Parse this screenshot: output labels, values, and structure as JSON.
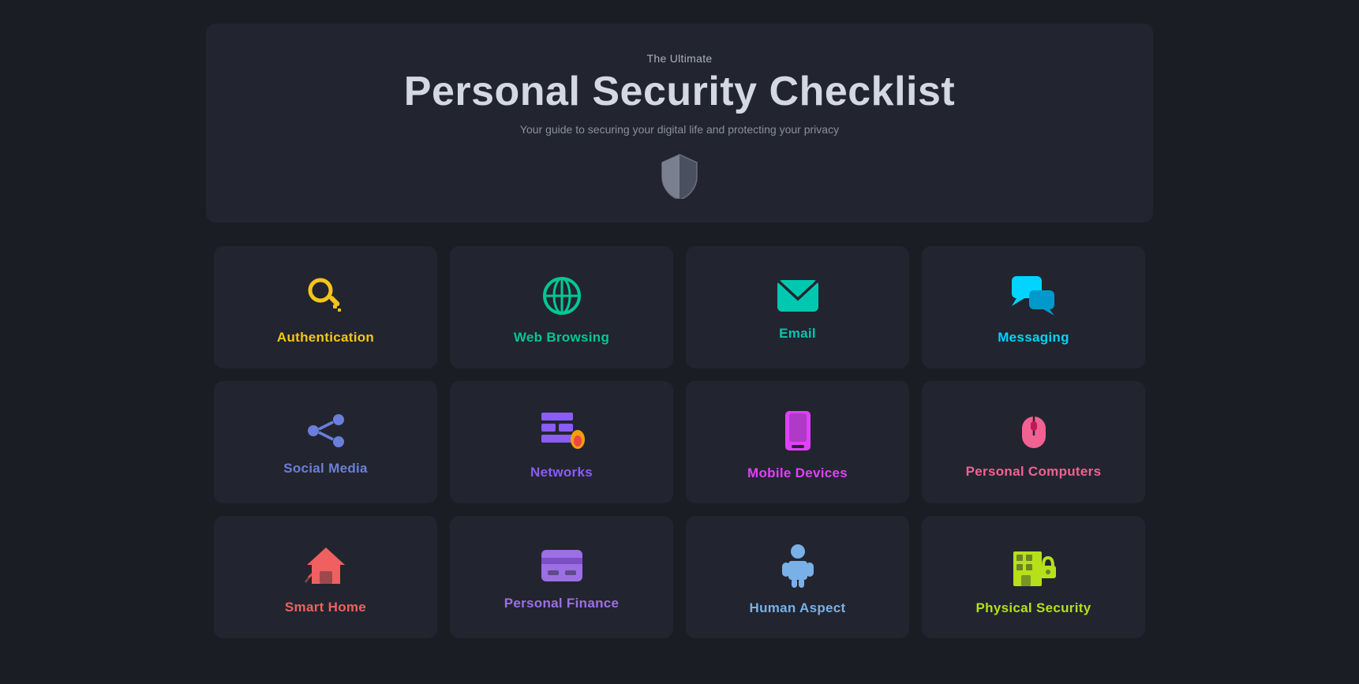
{
  "header": {
    "subtitle": "The Ultimate",
    "title": "Personal Security Checklist",
    "desc": "Your guide to securing your digital life and protecting your privacy"
  },
  "cards": [
    {
      "id": "authentication",
      "label": "Authentication",
      "icon_class": "icon-auth",
      "label_class": "label-auth"
    },
    {
      "id": "web-browsing",
      "label": "Web Browsing",
      "icon_class": "icon-web",
      "label_class": "label-web"
    },
    {
      "id": "email",
      "label": "Email",
      "icon_class": "icon-email",
      "label_class": "label-email"
    },
    {
      "id": "messaging",
      "label": "Messaging",
      "icon_class": "icon-messaging",
      "label_class": "label-messaging"
    },
    {
      "id": "social-media",
      "label": "Social Media",
      "icon_class": "icon-social",
      "label_class": "label-social"
    },
    {
      "id": "networks",
      "label": "Networks",
      "icon_class": "icon-networks",
      "label_class": "label-networks"
    },
    {
      "id": "mobile-devices",
      "label": "Mobile Devices",
      "icon_class": "icon-mobile",
      "label_class": "label-mobile"
    },
    {
      "id": "personal-computers",
      "label": "Personal Computers",
      "icon_class": "icon-pc",
      "label_class": "label-pc"
    },
    {
      "id": "smart-home",
      "label": "Smart Home",
      "icon_class": "icon-smarthome",
      "label_class": "label-smarthome"
    },
    {
      "id": "personal-finance",
      "label": "Personal Finance",
      "icon_class": "icon-finance",
      "label_class": "label-finance"
    },
    {
      "id": "human-aspect",
      "label": "Human Aspect",
      "icon_class": "icon-human",
      "label_class": "label-human"
    },
    {
      "id": "physical-security",
      "label": "Physical Security",
      "icon_class": "icon-physical",
      "label_class": "label-physical"
    }
  ]
}
